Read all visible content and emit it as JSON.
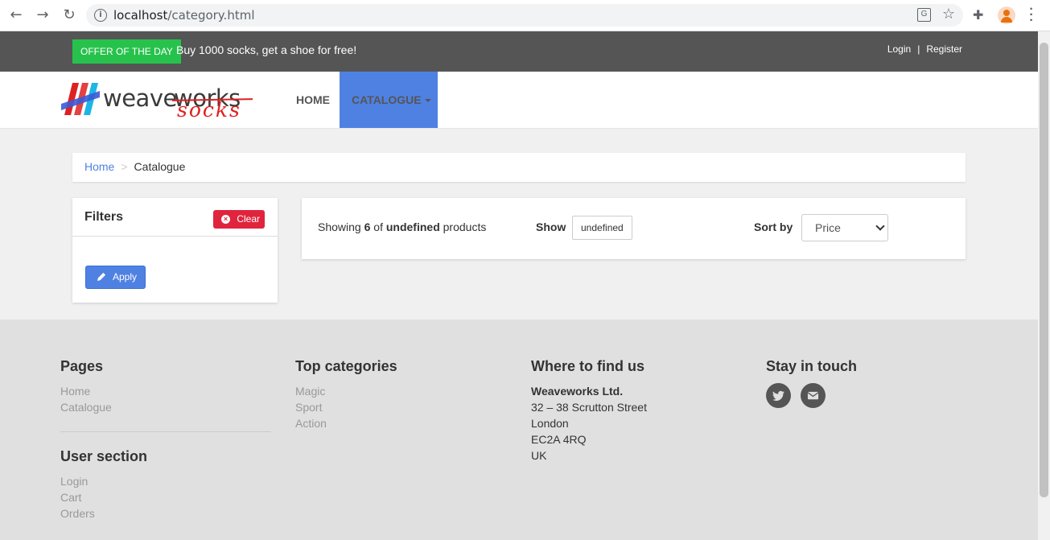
{
  "browser": {
    "url_host": "localhost",
    "url_path": "/category.html",
    "back_icon": "arrow-left",
    "forward_icon": "arrow-right",
    "reload_icon": "reload"
  },
  "topbar": {
    "offer_badge": "OFFER OF THE DAY",
    "offer_text": "Buy 1000 socks, get a shoe for free!",
    "login": "Login",
    "separator": "|",
    "register": "Register"
  },
  "navbar": {
    "logo_word_1": "weave",
    "logo_word_2": "works",
    "logo_word_3": "socks",
    "home": "HOME",
    "catalogue": "CATALOGUE",
    "active_color": "#4f81e3"
  },
  "breadcrumb": {
    "home": "Home",
    "separator": ">",
    "current": "Catalogue"
  },
  "filters": {
    "title": "Filters",
    "clear": "Clear",
    "apply": "Apply"
  },
  "products": {
    "showing_prefix": "Showing",
    "showing_count": "6",
    "showing_of": "of",
    "showing_total": "undefined",
    "showing_suffix": "products",
    "show_label": "Show",
    "show_value": "undefined",
    "sort_label": "Sort by",
    "sort_value": "Price"
  },
  "footer": {
    "pages": {
      "title": "Pages",
      "items": [
        "Home",
        "Catalogue"
      ]
    },
    "user_section": {
      "title": "User section",
      "items": [
        "Login",
        "Cart",
        "Orders"
      ]
    },
    "top_categories": {
      "title": "Top categories",
      "items": [
        "Magic",
        "Sport",
        "Action"
      ]
    },
    "where": {
      "title": "Where to find us",
      "company": "Weaveworks Ltd.",
      "lines": [
        "32 – 38 Scrutton Street",
        "London",
        "EC2A 4RQ",
        "UK"
      ]
    },
    "stay": {
      "title": "Stay in touch",
      "icons": [
        "twitter-icon",
        "envelope-icon"
      ]
    }
  }
}
